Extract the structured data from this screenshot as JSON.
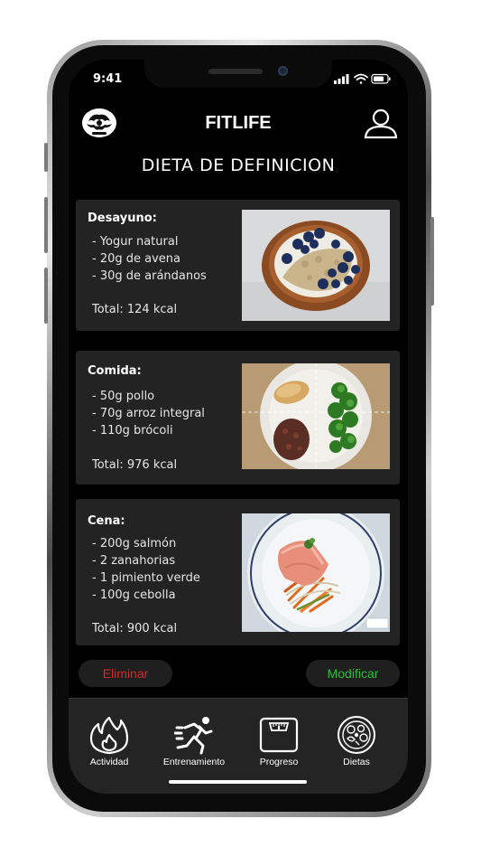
{
  "status_bar": {
    "time": "9:41"
  },
  "app": {
    "title": "FITLIFE"
  },
  "page": {
    "title": "DIETA DE DEFINICION"
  },
  "meals": [
    {
      "title": "Desayuno:",
      "items": [
        "- Yogur natural",
        "- 20g de avena",
        "- 30g de arándanos"
      ],
      "total": "Total: 124 kcal"
    },
    {
      "title": "Comida:",
      "items": [
        "- 50g pollo",
        "- 70g arroz integral",
        "- 110g brócoli"
      ],
      "total": "Total: 976 kcal"
    },
    {
      "title": "Cena:",
      "items": [
        "- 200g salmón",
        "- 2 zanahorias",
        "- 1 pimiento verde",
        "- 100g cebolla"
      ],
      "total": "Total: 900 kcal"
    }
  ],
  "actions": {
    "delete_label": "Eliminar",
    "edit_label": "Modificar"
  },
  "colors": {
    "delete": "#d62828",
    "edit": "#2fbf3a",
    "background": "#000000",
    "card": "#232323"
  },
  "tabs": [
    {
      "label": "Actividad",
      "icon": "flame-icon"
    },
    {
      "label": "Entrenamiento",
      "icon": "runner-icon"
    },
    {
      "label": "Progreso",
      "icon": "scale-icon"
    },
    {
      "label": "Dietas",
      "icon": "food-plate-icon"
    }
  ]
}
